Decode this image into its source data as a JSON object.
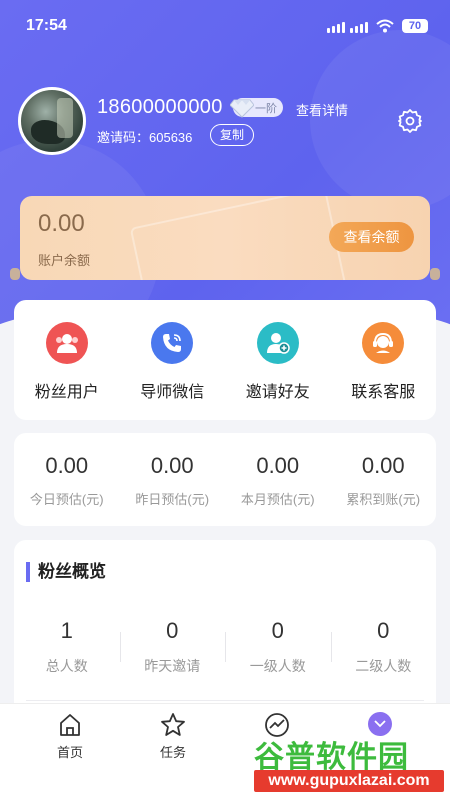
{
  "status_bar": {
    "time": "17:54",
    "battery": "70",
    "icons": [
      "signal-icon",
      "wifi-icon",
      "battery-icon"
    ]
  },
  "profile": {
    "phone": "18600000000",
    "level": "一阶",
    "view_detail": "查看详情",
    "invite_code_label": "邀请码：605636",
    "copy_label": "复制"
  },
  "balance": {
    "amount": "0.00",
    "label": "账户余额",
    "button_label": "查看余额"
  },
  "menu": [
    {
      "label": "粉丝用户",
      "icon": "fans-users-icon",
      "color": "#ef5454"
    },
    {
      "label": "导师微信",
      "icon": "phone-call-icon",
      "color": "#4a78ee"
    },
    {
      "label": "邀请好友",
      "icon": "add-friend-icon",
      "color": "#2bbcc6"
    },
    {
      "label": "联系客服",
      "icon": "customer-service-icon",
      "color": "#f58c3a"
    }
  ],
  "stats": [
    {
      "value": "0.00",
      "label": "今日预估(元)"
    },
    {
      "value": "0.00",
      "label": "昨日预估(元)"
    },
    {
      "value": "0.00",
      "label": "本月预估(元)"
    },
    {
      "value": "0.00",
      "label": "累积到账(元)"
    }
  ],
  "fans_overview": {
    "title": "粉丝概览",
    "items": [
      {
        "value": "1",
        "label": "总人数"
      },
      {
        "value": "0",
        "label": "昨天邀请"
      },
      {
        "value": "0",
        "label": "一级人数"
      },
      {
        "value": "0",
        "label": "二级人数"
      }
    ]
  },
  "tabbar": [
    {
      "label": "首页",
      "icon": "home-icon"
    },
    {
      "label": "任务",
      "icon": "star-icon"
    },
    {
      "label": "",
      "icon": "trend-icon"
    },
    {
      "label": "",
      "icon": "chevron-down-icon"
    }
  ],
  "watermark": {
    "name": "谷普软件园",
    "url": "www.gupuxlazai.com"
  },
  "colors": {
    "primary": "#5e63ee",
    "balance_card": "#f8d8b6",
    "balance_button": "#f0a050",
    "title_accent": "#6a6cf2"
  }
}
